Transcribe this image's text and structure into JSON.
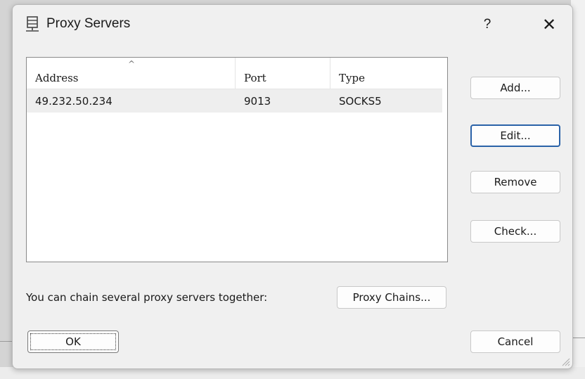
{
  "dialog": {
    "title": "Proxy Servers",
    "title_icon": "server-icon",
    "help_label": "?",
    "close_label": "✕"
  },
  "list": {
    "sort_indicator": "^",
    "columns": [
      "Address",
      "Port",
      "Type"
    ],
    "rows": [
      {
        "address": "49.232.50.234",
        "port": "9013",
        "type": "SOCKS5"
      }
    ]
  },
  "buttons": {
    "add": "Add...",
    "edit": "Edit...",
    "remove": "Remove",
    "check": "Check...",
    "proxy_chains": "Proxy Chains...",
    "ok": "OK",
    "cancel": "Cancel"
  },
  "chain_label": "You can chain several proxy servers together:",
  "colors": {
    "focus_border": "#2a62a8",
    "row_selected_bg": "#eeeeee"
  }
}
